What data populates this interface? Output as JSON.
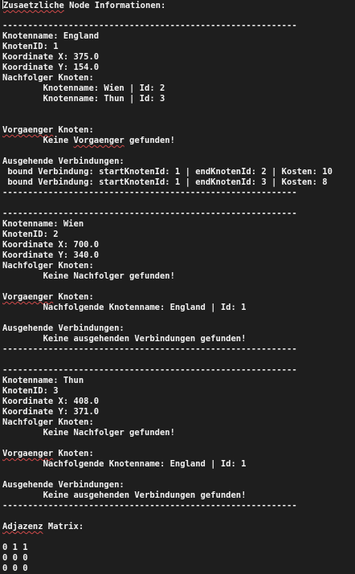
{
  "terminal": {
    "lines": [
      "Zusaetzliche Node Informationen:",
      "",
      "----------------------------------------------------------",
      "Knotenname: England",
      "KnotenID: 1",
      "Koordinate X: 375.0",
      "Koordinate Y: 154.0",
      "Nachfolger Knoten:",
      "        Knotenname: Wien | Id: 2",
      "        Knotenname: Thun | Id: 3",
      "",
      "",
      "Vorgaenger Knoten:",
      "        Keine Vorgaenger gefunden!",
      "",
      "Ausgehende Verbindungen:",
      " bound Verbindung: startKnotenId: 1 | endKnotenId: 2 | Kosten: 10",
      " bound Verbindung: startKnotenId: 1 | endKnotenId: 3 | Kosten: 8",
      "----------------------------------------------------------",
      "",
      "----------------------------------------------------------",
      "Knotenname: Wien",
      "KnotenID: 2",
      "Koordinate X: 700.0",
      "Koordinate Y: 340.0",
      "Nachfolger Knoten:",
      "        Keine Nachfolger gefunden!",
      "",
      "Vorgaenger Knoten:",
      "        Nachfolgende Knotenname: England | Id: 1",
      "",
      "Ausgehende Verbindungen:",
      "        Keine ausgehenden Verbindungen gefunden!",
      "----------------------------------------------------------",
      "",
      "----------------------------------------------------------",
      "Knotenname: Thun",
      "KnotenID: 3",
      "Koordinate X: 408.0",
      "Koordinate Y: 371.0",
      "Nachfolger Knoten:",
      "        Keine Nachfolger gefunden!",
      "",
      "Vorgaenger Knoten:",
      "        Nachfolgende Knotenname: England | Id: 1",
      "",
      "Ausgehende Verbindungen:",
      "        Keine ausgehenden Verbindungen gefunden!",
      "----------------------------------------------------------",
      "",
      "Adjazenz Matrix:",
      "",
      "0 1 1",
      "0 0 0",
      "0 0 0"
    ],
    "spellcheck_words": [
      "Zusaetzliche",
      "Vorgaenger",
      "Adjazenz"
    ],
    "colors": {
      "background": "#1e1e1e",
      "text": "#f2f2f2",
      "spellcheck_underline": "#d24a4a"
    }
  }
}
